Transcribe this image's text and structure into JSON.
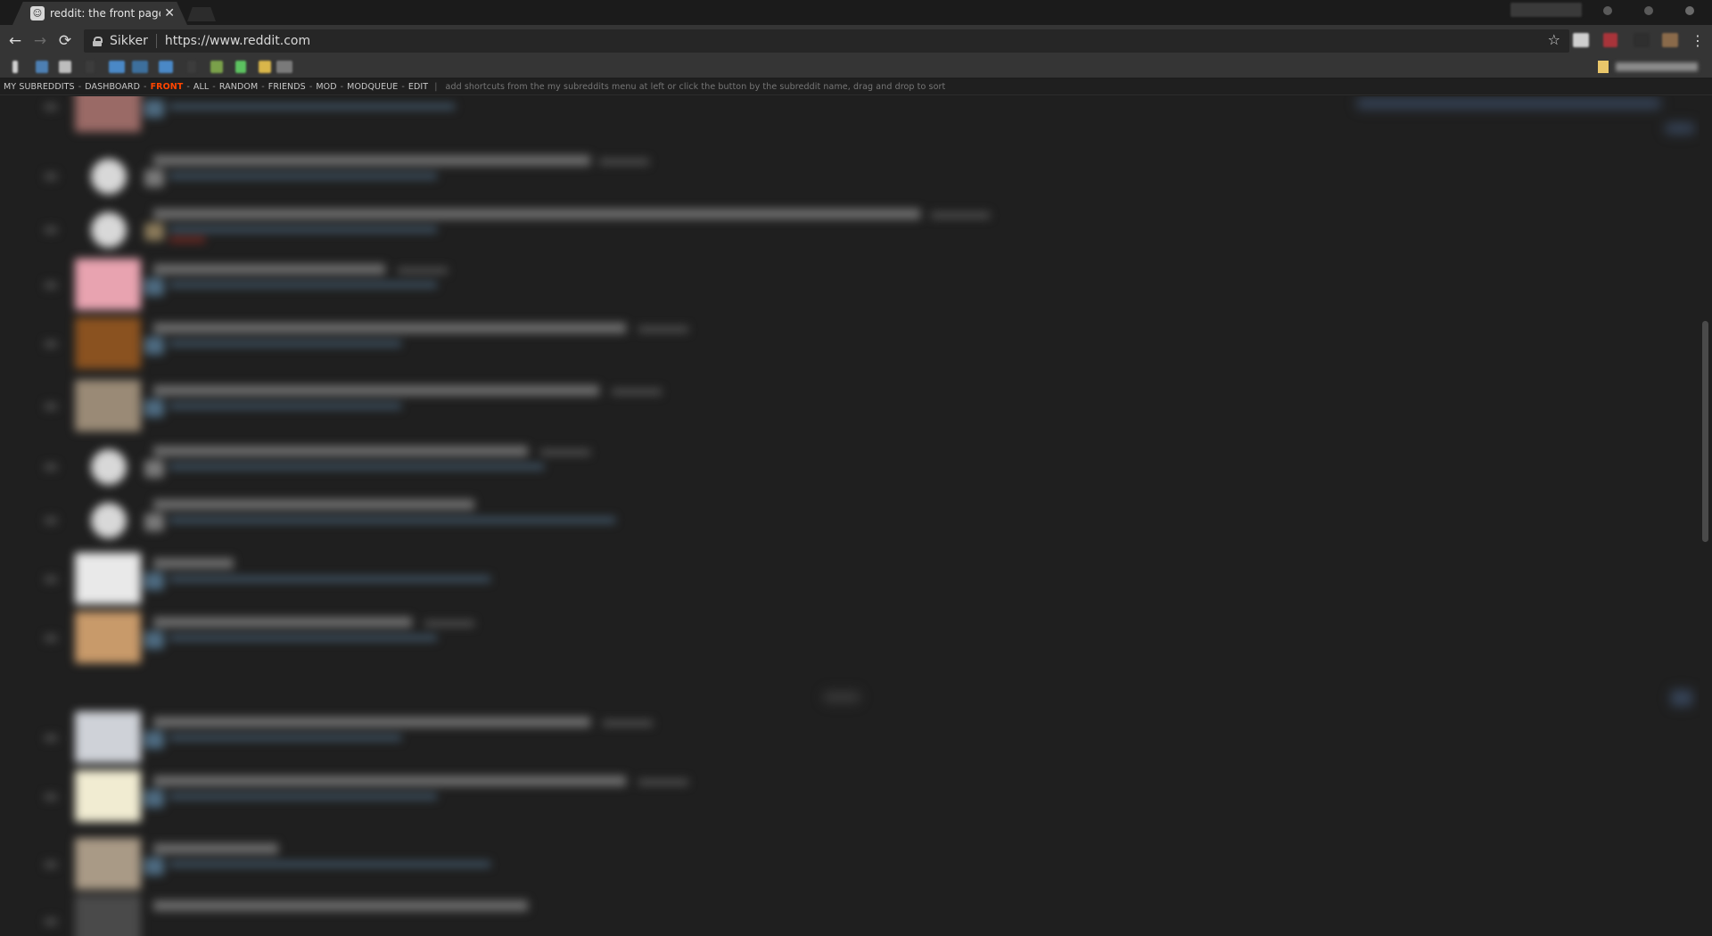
{
  "browser": {
    "tab": {
      "title": "reddit: the front page of",
      "close_glyph": "✕",
      "favicon": "reddit-alien-icon"
    },
    "nav": {
      "back": "←",
      "forward": "→",
      "reload": "⟳"
    },
    "omnibox": {
      "security_label": "Sikker",
      "url": "https://www.reddit.com",
      "bookmark_star": "☆"
    },
    "menu_glyph": "⋮"
  },
  "reddit_header": {
    "items": [
      {
        "label": "MY SUBREDDITS",
        "active": false
      },
      {
        "label": "DASHBOARD",
        "active": false
      },
      {
        "label": "FRONT",
        "active": true
      },
      {
        "label": "ALL",
        "active": false
      },
      {
        "label": "RANDOM",
        "active": false
      },
      {
        "label": "FRIENDS",
        "active": false
      },
      {
        "label": "MOD",
        "active": false
      },
      {
        "label": "MODQUEUE",
        "active": false
      },
      {
        "label": "EDIT",
        "active": false
      }
    ],
    "separator": "-",
    "pipe": "|",
    "hint": "add shortcuts from the my subreddits menu at left or click the button by the subreddit name, drag and drop to sort"
  },
  "colors": {
    "active_link": "#ff4500",
    "page_bg": "#1f1f1f",
    "toolbar_bg": "#353535"
  }
}
